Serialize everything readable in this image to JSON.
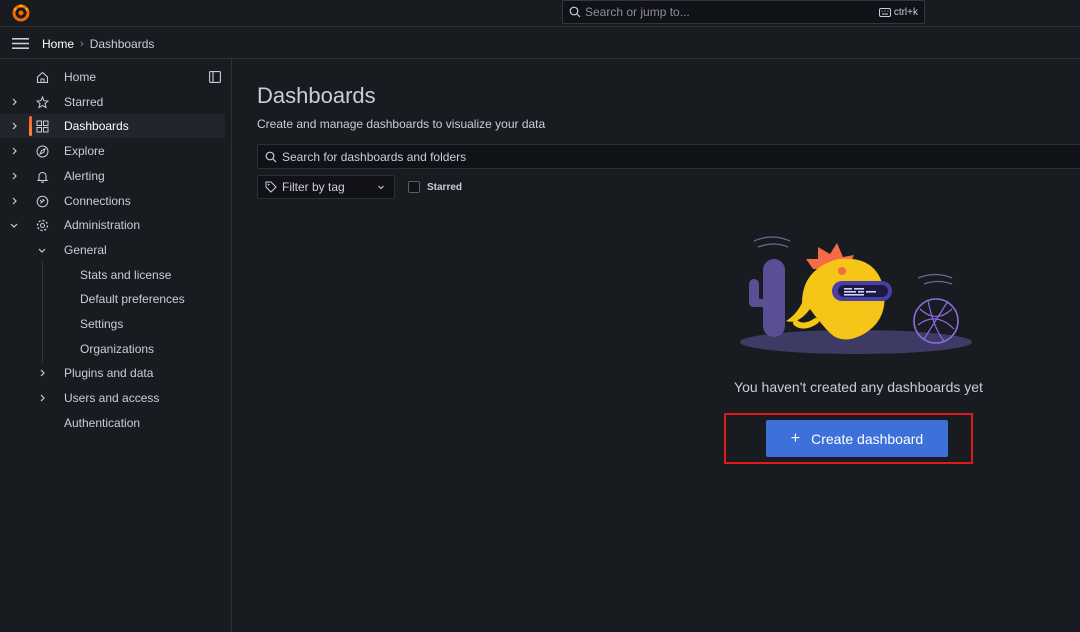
{
  "topbar": {
    "logo_icon": "grafana-logo",
    "search": {
      "placeholder": "Search or jump to...",
      "shortcut": "ctrl+k"
    }
  },
  "breadcrumb": {
    "home": "Home",
    "separator": "›",
    "current": "Dashboards"
  },
  "sidebar": {
    "items": [
      {
        "label": "Home",
        "icon": "home-icon",
        "expandable": false
      },
      {
        "label": "Starred",
        "icon": "star-icon",
        "expandable": true
      },
      {
        "label": "Dashboards",
        "icon": "apps-icon",
        "expandable": true,
        "active": true
      },
      {
        "label": "Explore",
        "icon": "compass-icon",
        "expandable": true
      },
      {
        "label": "Alerting",
        "icon": "bell-icon",
        "expandable": true
      },
      {
        "label": "Connections",
        "icon": "plug-icon",
        "expandable": true
      },
      {
        "label": "Administration",
        "icon": "cog-icon",
        "expandable": true,
        "expanded": true
      }
    ],
    "admin_children": [
      {
        "label": "General",
        "expanded": true
      },
      {
        "label": "Stats and license"
      },
      {
        "label": "Default preferences"
      },
      {
        "label": "Settings"
      },
      {
        "label": "Organizations"
      },
      {
        "label": "Plugins and data",
        "expandable": true
      },
      {
        "label": "Users and access",
        "expandable": true
      },
      {
        "label": "Authentication"
      }
    ]
  },
  "main": {
    "title": "Dashboards",
    "subtitle": "Create and manage dashboards to visualize your data",
    "search_placeholder": "Search for dashboards and folders",
    "tag_filter_placeholder": "Filter by tag",
    "starred_label": "Starred",
    "empty_message": "You haven't created any dashboards yet",
    "create_button": "Create dashboard"
  },
  "colors": {
    "background": "#181b1f",
    "accent_blue": "#3d71d9",
    "active_indicator": "#f55f3e",
    "highlight_border": "#e01a1a"
  }
}
